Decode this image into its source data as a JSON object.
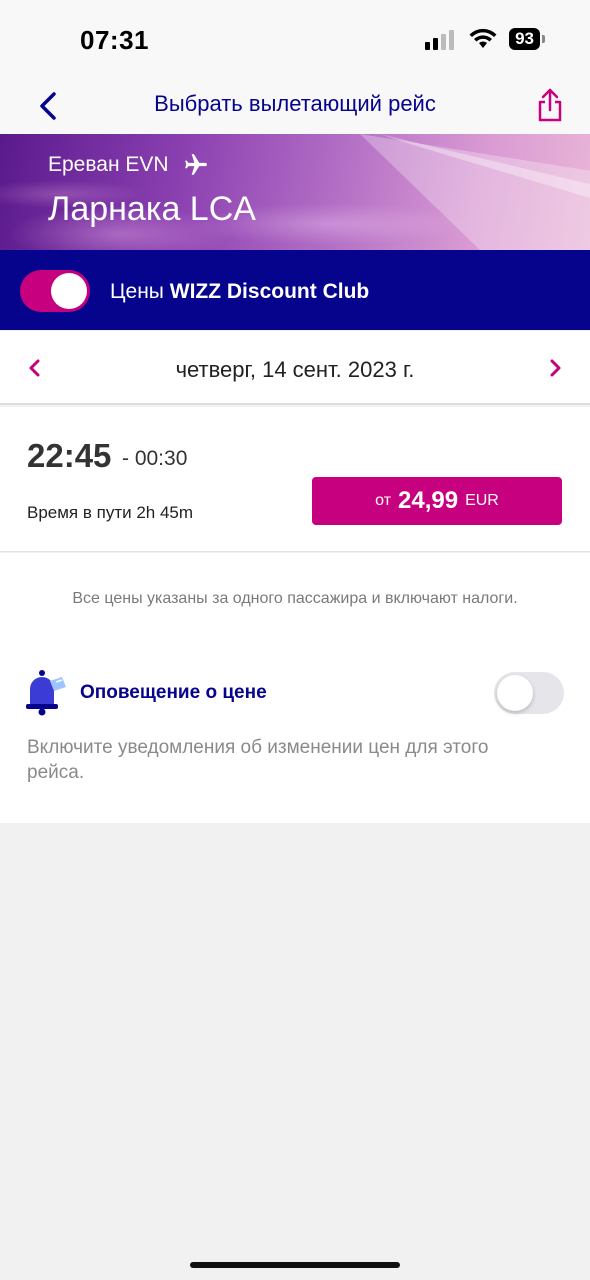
{
  "status_bar": {
    "time": "07:31",
    "battery": "93"
  },
  "nav": {
    "title": "Выбрать вылетающий рейс"
  },
  "route": {
    "origin": "Ереван EVN",
    "destination": "Ларнака LCA"
  },
  "club": {
    "prefix": "Цены",
    "name": "WIZZ Discount Club",
    "enabled": true
  },
  "date": {
    "label": "четверг, 14 сент. 2023 г."
  },
  "flight": {
    "departure": "22:45",
    "arrival": "- 00:30",
    "duration": "Время в пути 2h 45m",
    "price_from": "от",
    "price_amount": "24,99",
    "price_currency": "EUR"
  },
  "info": {
    "tax_note": "Все цены указаны за одного пассажира и включают налоги.",
    "alert_title": "Оповещение о цене",
    "alert_desc": "Включите уведомления об изменении цен для этого рейса.",
    "alert_enabled": false
  },
  "colors": {
    "brand_navy": "#06038d",
    "brand_magenta": "#c6007e"
  }
}
